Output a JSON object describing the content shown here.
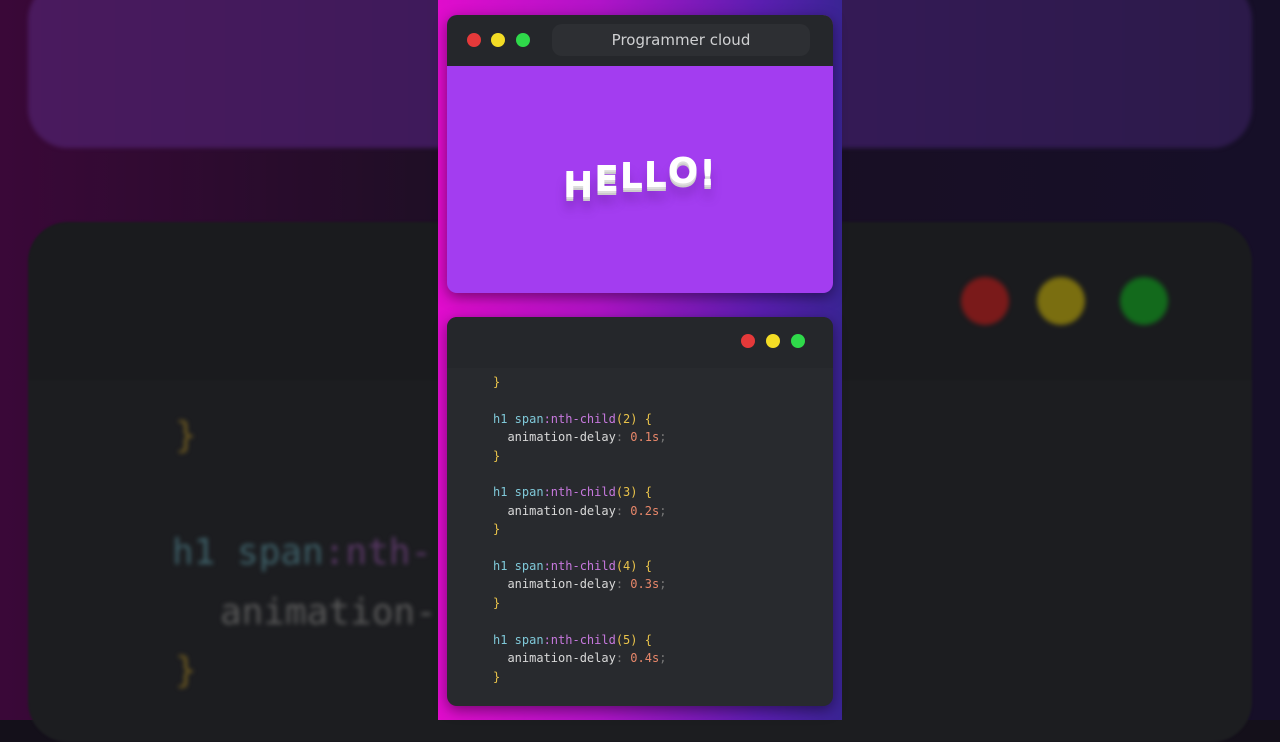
{
  "window": {
    "title": "Programmer cloud"
  },
  "preview": {
    "letters": [
      "H",
      "E",
      "L",
      "L",
      "O",
      "!"
    ]
  },
  "code_lines": [
    {
      "sel": "",
      "pseudo": "",
      "arg": "",
      "prop": "",
      "val": "",
      "close": "}"
    },
    {
      "sel": "h1 span",
      "pseudo": ":nth-child",
      "arg": "(2)",
      "open": " {",
      "prop": "animation-delay",
      "val": "0.1s",
      "close": "}"
    },
    {
      "sel": "h1 span",
      "pseudo": ":nth-child",
      "arg": "(3)",
      "open": " {",
      "prop": "animation-delay",
      "val": "0.2s",
      "close": "}"
    },
    {
      "sel": "h1 span",
      "pseudo": ":nth-child",
      "arg": "(4)",
      "open": " {",
      "prop": "animation-delay",
      "val": "0.3s",
      "close": "}"
    },
    {
      "sel": "h1 span",
      "pseudo": ":nth-child",
      "arg": "(5)",
      "open": " {",
      "prop": "animation-delay",
      "val": "0.4s",
      "close": "}"
    }
  ],
  "backdrop": {
    "brace1": "}",
    "sel": "h1 span",
    "pseudo": ":nth-",
    "prop": "animation-",
    "brace2": "}"
  },
  "colors": {
    "accent": "#a33df0",
    "red": "#e5393a",
    "yellow": "#f3dc25",
    "green": "#2fd94a"
  }
}
